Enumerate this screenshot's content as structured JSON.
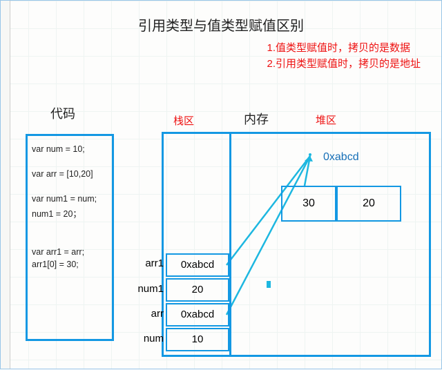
{
  "title": "引用类型与值类型赋值区别",
  "notes": {
    "n1": "1.值类型赋值时，拷贝的是数据",
    "n2": "2.引用类型赋值时，拷贝的是地址"
  },
  "labels": {
    "code": "代码",
    "stack": "栈区",
    "memory": "内存",
    "heap": "堆区"
  },
  "code": {
    "l1": "var num = 10;",
    "l2": "var arr = [10,20]",
    "l3": "var num1 = num;",
    "l4": "num1 = 20；",
    "l5": "var arr1 = arr;",
    "l6": "arr1[0] = 30;"
  },
  "stack": {
    "arr1": {
      "label": "arr1",
      "value": "0xabcd"
    },
    "num1": {
      "label": "num1",
      "value": "20"
    },
    "arr": {
      "label": "arr",
      "value": "0xabcd"
    },
    "num": {
      "label": "num",
      "value": "10"
    }
  },
  "heap": {
    "addr": "0xabcd",
    "cell0": "30",
    "cell1": "20"
  }
}
